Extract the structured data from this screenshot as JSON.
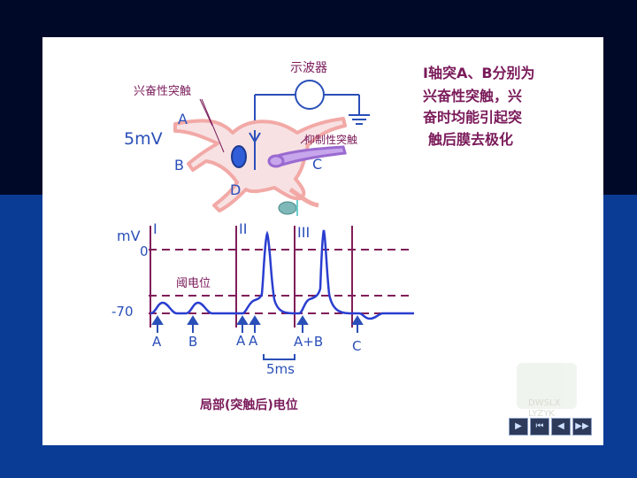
{
  "oscilloscope_label": "示波器",
  "excitatory_synapse_label": "兴奋性突触",
  "inhibitory_synapse_label": "抑制性突触",
  "voltage_scale": "5mV",
  "terminal_labels": {
    "a": "A",
    "b": "B",
    "c": "C",
    "d": "D"
  },
  "explanation_lines": [
    "Ⅰ轴突A、B分别为",
    "兴奋性突触，兴",
    "奋时均能引起突",
    "触后膜去极化"
  ],
  "trace": {
    "unit": "mV",
    "zero": "0",
    "rest": "-70",
    "threshold_label": "阈电位",
    "sections": [
      "I",
      "II",
      "III"
    ],
    "stimuli": [
      "A",
      "B",
      "A",
      "A",
      "A+B",
      "C"
    ],
    "time_scale": "5ms",
    "caption": "局部(突触后)电位"
  },
  "watermark": [
    "DWSLX",
    "LYZYK"
  ],
  "nav_buttons": {
    "play": "▶",
    "first": "⏮",
    "prev": "◀",
    "next": "▶▶"
  },
  "colors": {
    "text_blue": "#2a4fb8",
    "caption_purple": "#7a1a5a",
    "dashed": "#801e5a",
    "trace": "#2a3ed0",
    "neuron": "#f2a9a6",
    "inhibitory_axon": "#9a6ad0"
  }
}
